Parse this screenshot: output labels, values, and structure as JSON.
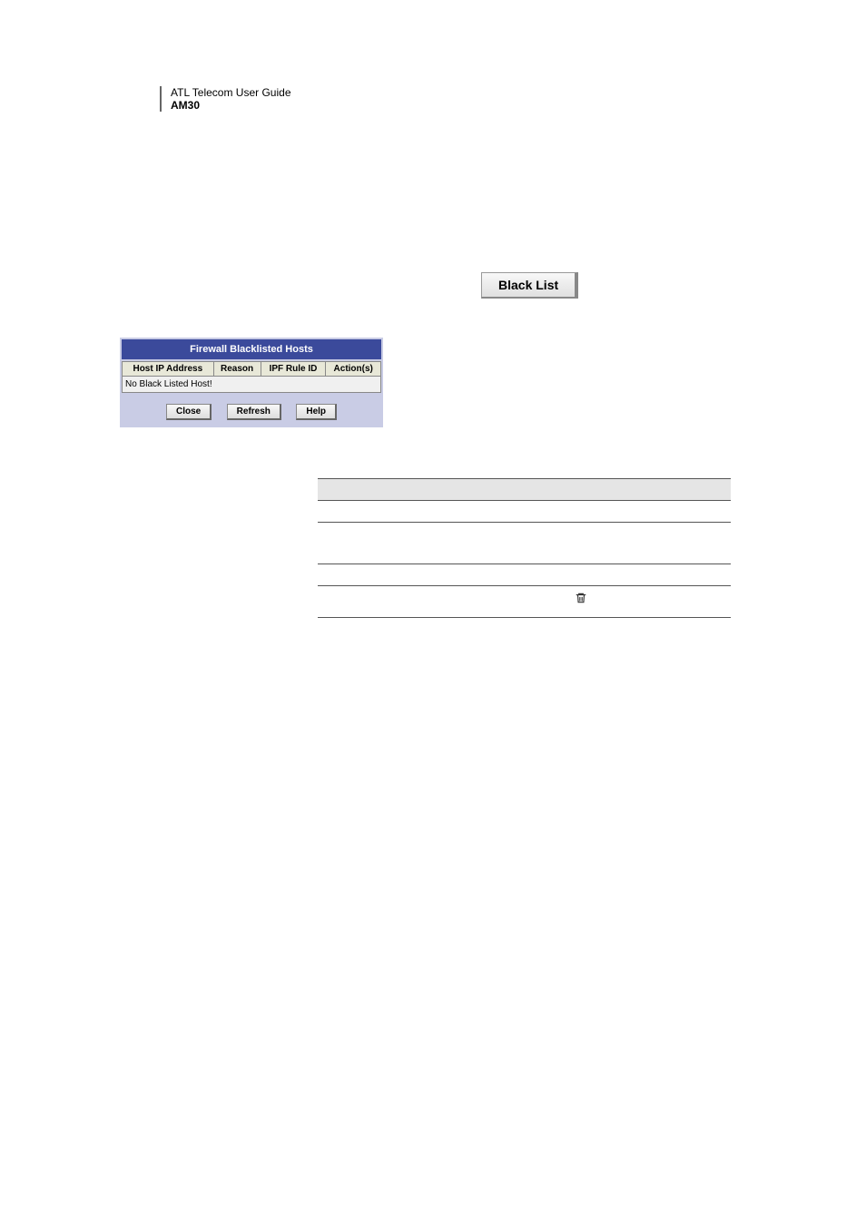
{
  "header": {
    "line1": "ATL Telecom User Guide",
    "line2": "AM30"
  },
  "blacklist_button": {
    "label": "Black List"
  },
  "firewall": {
    "title": "Firewall Blacklisted Hosts",
    "columns": [
      "Host IP Address",
      "Reason",
      "IPF Rule ID",
      "Action(s)"
    ],
    "empty_message": "No Black Listed Host!",
    "buttons": {
      "close": "Close",
      "refresh": "Refresh",
      "help": "Help"
    }
  },
  "icons": {
    "trash": "trash-icon"
  }
}
